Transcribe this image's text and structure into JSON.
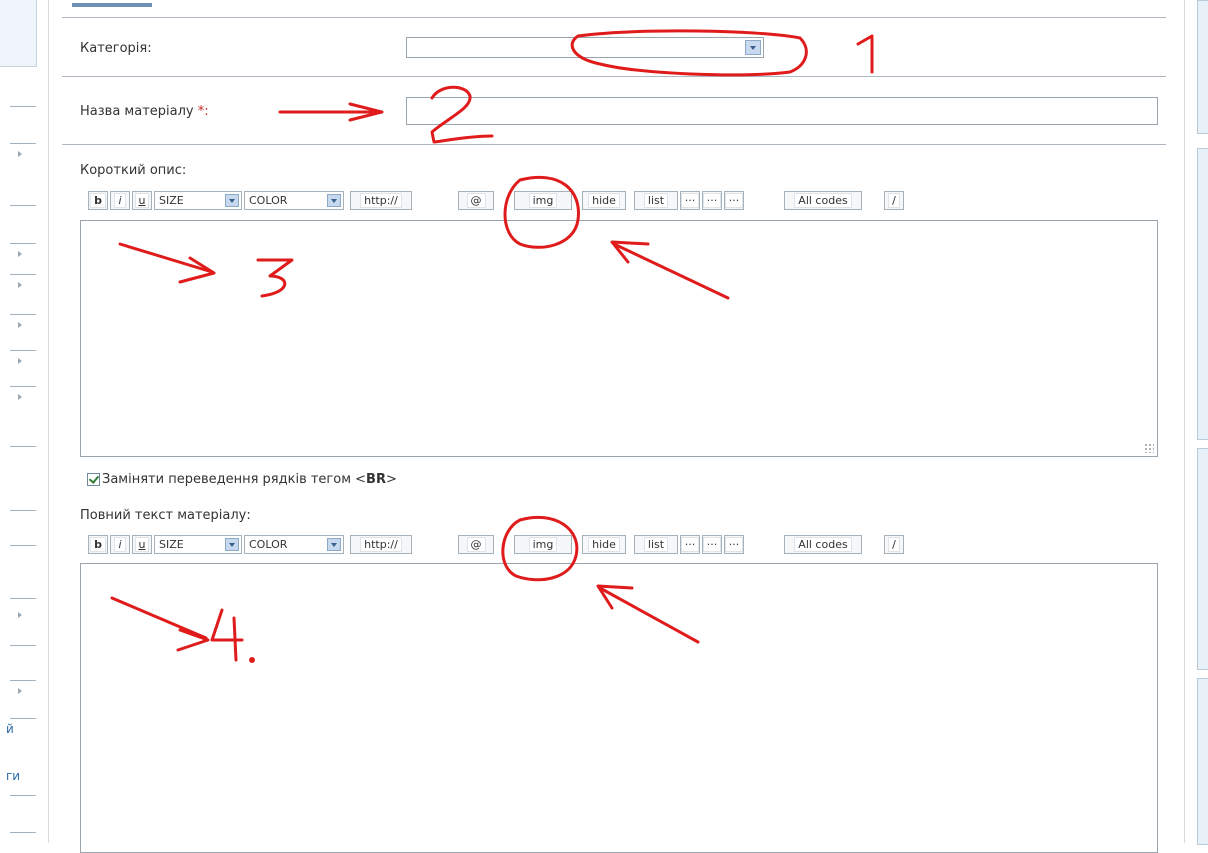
{
  "form": {
    "category_label": "Категорія:",
    "title_label": "Назва матеріалу ",
    "title_required": "*:",
    "short_label": "Короткий опис:",
    "replace_br_label": "Заміняти переведення рядків тегом <",
    "replace_br_tag": "BR",
    "replace_br_end": ">",
    "replace_br_checked": true,
    "full_label": "Повний текст матеріалу:"
  },
  "toolbar": {
    "b": "b",
    "i": "i",
    "u": "u",
    "size": "SIZE",
    "color": "COLOR",
    "url": "http://",
    "email": "@",
    "img": "img",
    "hide": "hide",
    "list": "list",
    "dots1": "···",
    "dots2": "···",
    "dots3": "···",
    "all_codes": "All codes",
    "close": "/"
  },
  "sidebar": {
    "left_texts": [
      "й",
      "ги"
    ]
  },
  "annotations": {
    "color": "#e01b1b",
    "labels": [
      "1",
      "2",
      "3",
      "4."
    ]
  }
}
